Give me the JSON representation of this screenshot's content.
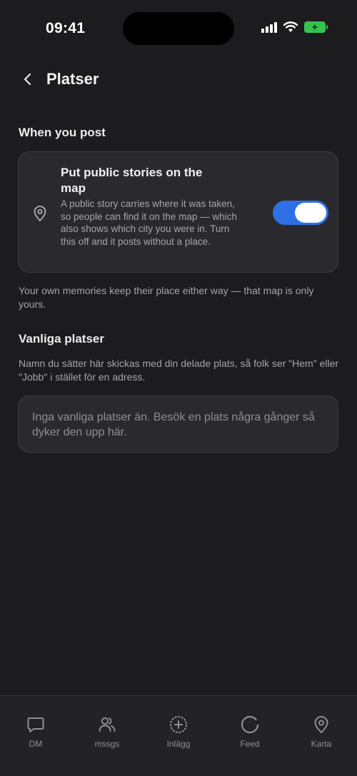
{
  "status_bar": {
    "time": "09:41",
    "icons": [
      "signal-icon",
      "wifi-icon",
      "battery-charging-icon"
    ],
    "battery_color": "#36c24e"
  },
  "header": {
    "back_icon": "chevron-left-icon",
    "title": "Platser"
  },
  "when_you_post": {
    "section_title": "When you post",
    "toggle_title": "Put public stories on the map",
    "toggle_description": "A public story carries where it was taken, so people can find it on the map — which also shows which city you were in. Turn this off and it posts without a place.",
    "toggle_on": true,
    "toggle_color": "#2f6fe4",
    "icon": "map-pin-icon",
    "footnote": "Your own memories keep their place either way — that map is only yours."
  },
  "common_places": {
    "section_title": "Vanliga platser",
    "description": "Namn du sätter här skickas med din delade plats, så folk ser \"Hem\" eller \"Jobb\" i stället för en adress.",
    "empty_text": "Inga vanliga platser än. Besök en plats några gånger så dyker den upp här."
  },
  "tab_bar": {
    "tabs": [
      {
        "label": "DM",
        "icon": "chat-bubble-icon"
      },
      {
        "label": "mssgs",
        "icon": "people-icon"
      },
      {
        "label": "Inlägg",
        "icon": "plus-circle-icon"
      },
      {
        "label": "Feed",
        "icon": "circle-icon"
      },
      {
        "label": "Karta",
        "icon": "map-pin-icon"
      }
    ]
  }
}
